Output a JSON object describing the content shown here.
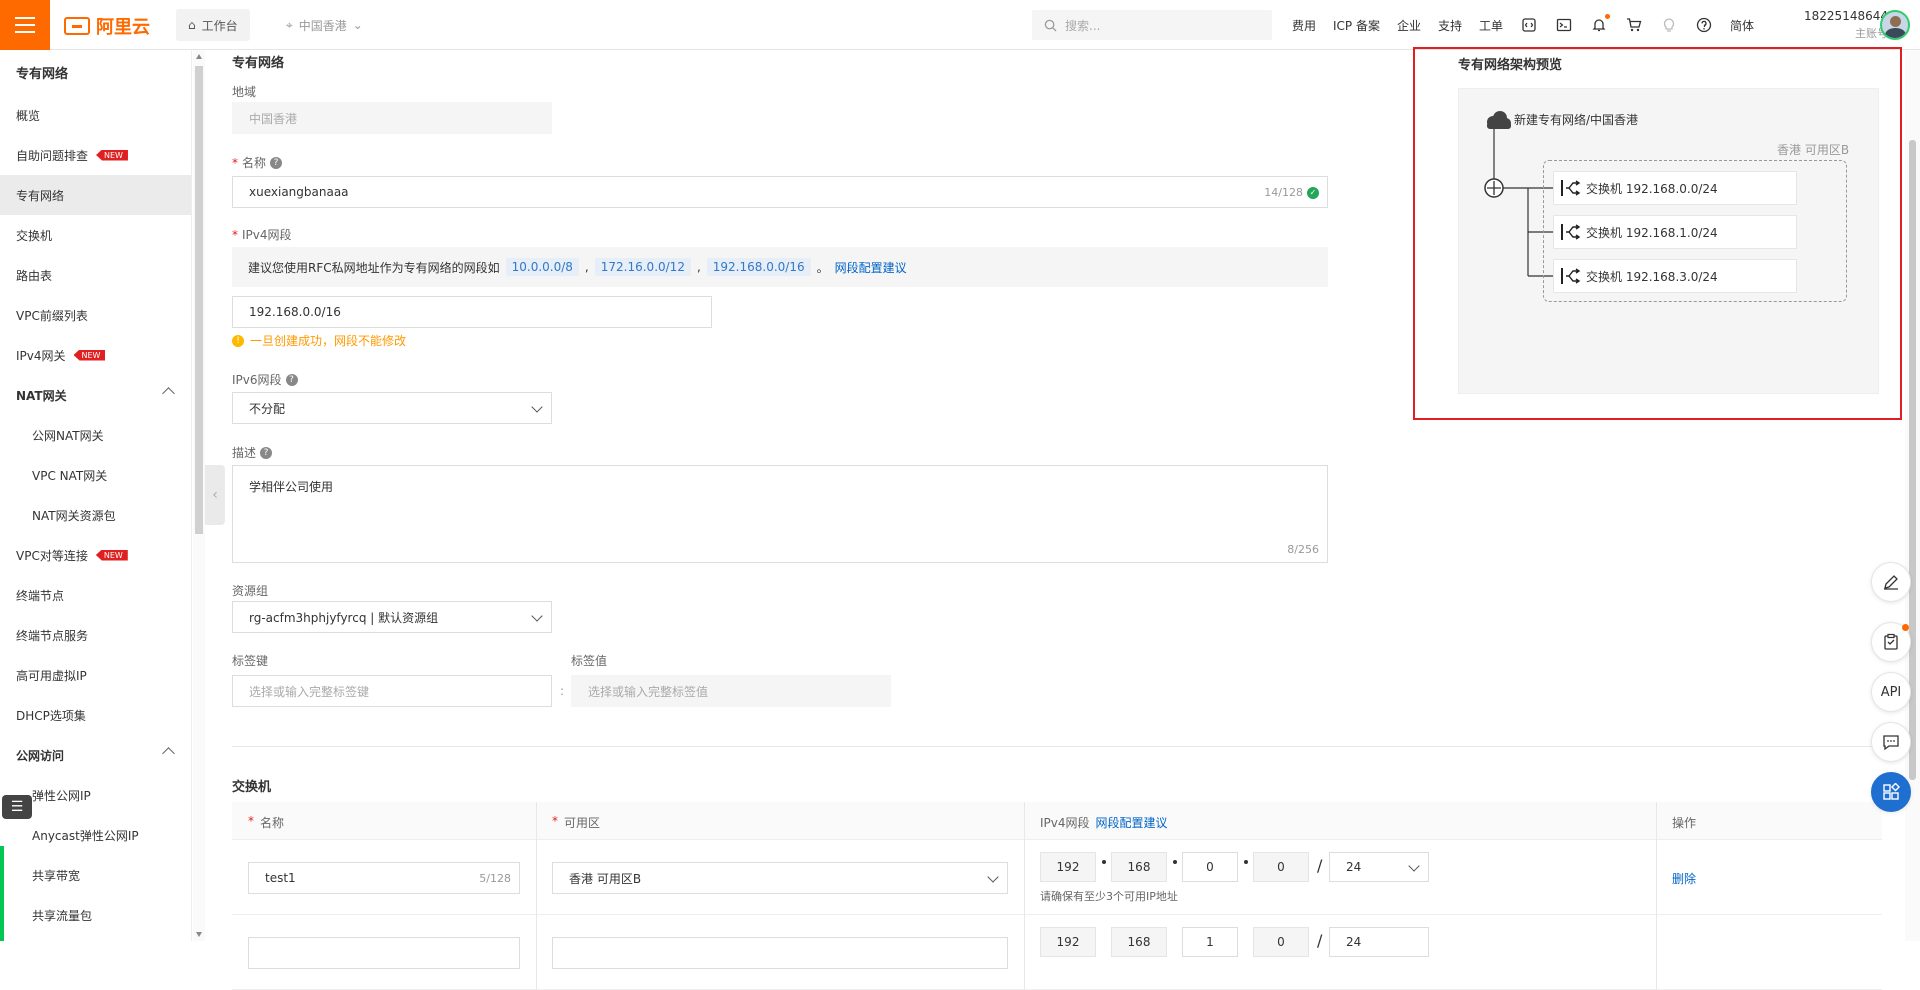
{
  "topbar": {
    "logo_text": "阿里云",
    "workbench": "工作台",
    "region": "中国香港",
    "search_placeholder": "搜索...",
    "links": [
      "费用",
      "ICP 备案",
      "企业",
      "支持",
      "工单"
    ],
    "lang": "简体",
    "account_id": "18225148644",
    "account_role": "主账号",
    "brand_color": "#ff6a00"
  },
  "sidebar": {
    "title": "专有网络",
    "items": [
      {
        "label": "概览"
      },
      {
        "label": "自助问题排查",
        "badge": "NEW"
      },
      {
        "label": "专有网络",
        "active": true
      },
      {
        "label": "交换机"
      },
      {
        "label": "路由表"
      },
      {
        "label": "VPC前缀列表"
      },
      {
        "label": "IPv4网关",
        "badge": "NEW"
      },
      {
        "label": "NAT网关",
        "group": true
      },
      {
        "label": "公网NAT网关",
        "sub": true
      },
      {
        "label": "VPC NAT网关",
        "sub": true
      },
      {
        "label": "NAT网关资源包",
        "sub": true
      },
      {
        "label": "VPC对等连接",
        "badge": "NEW"
      },
      {
        "label": "终端节点"
      },
      {
        "label": "终端节点服务"
      },
      {
        "label": "高可用虚拟IP"
      },
      {
        "label": "DHCP选项集"
      },
      {
        "label": "公网访问",
        "group": true
      },
      {
        "label": "弹性公网IP",
        "sub": true
      },
      {
        "label": "Anycast弹性公网IP",
        "sub": true
      },
      {
        "label": "共享带宽",
        "sub": true
      },
      {
        "label": "共享流量包",
        "sub": true
      }
    ]
  },
  "form": {
    "section_title": "专有网络",
    "region_label": "地域",
    "region_value": "中国香港",
    "name_label": "名称",
    "name_value": "xuexiangbanaaa",
    "name_count": "14/128",
    "ipv4_label": "IPv4网段",
    "ipv4_hint": "建议您使用RFC私网地址作为专有网络的网段如",
    "ipv4_suggestions": [
      "10.0.0.0/8",
      "172.16.0.0/12",
      "192.168.0.0/16"
    ],
    "ipv4_advice_link": "网段配置建议",
    "ipv4_value": "192.168.0.0/16",
    "ipv4_warning": "一旦创建成功，网段不能修改",
    "ipv6_label": "IPv6网段",
    "ipv6_value": "不分配",
    "desc_label": "描述",
    "desc_value": "学相伴公司使用",
    "desc_count": "8/256",
    "rg_label": "资源组",
    "rg_value": "rg-acfm3hphjyfyrcq | 默认资源组",
    "tag_key_label": "标签键",
    "tag_key_placeholder": "选择或输入完整标签键",
    "tag_val_label": "标签值",
    "tag_val_placeholder": "选择或输入完整标签值"
  },
  "switches": {
    "section_title": "交换机",
    "col_name": "名称",
    "col_zone": "可用区",
    "col_ipv4": "IPv4网段",
    "col_ipv4_link": "网段配置建议",
    "col_action": "操作",
    "rows": [
      {
        "name": "test1",
        "name_count": "5/128",
        "zone": "香港 可用区B",
        "ip": [
          "192",
          "168",
          "0",
          "0"
        ],
        "mask": "24",
        "ip_note": "请确保有至少3个可用IP地址",
        "action": "删除"
      },
      {
        "ip": [
          "192",
          "168",
          "1",
          "0"
        ],
        "mask": "24"
      }
    ]
  },
  "preview": {
    "title": "专有网络架构预览",
    "vpc_label": "新建专有网络/中国香港",
    "zone_label": "香港 可用区B",
    "switches": [
      "交换机 192.168.0.0/24",
      "交换机 192.168.1.0/24",
      "交换机 192.168.3.0/24"
    ]
  },
  "fabs": [
    "edit-icon",
    "clipboard-icon",
    "API",
    "chat-icon",
    "apps-icon"
  ]
}
